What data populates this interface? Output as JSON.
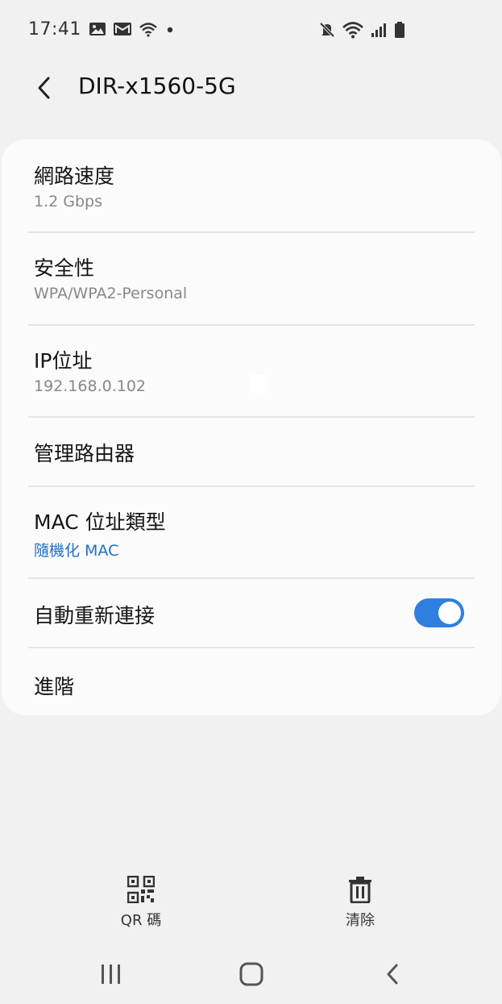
{
  "status_bar": {
    "time": "17:41",
    "left_icons": [
      "gallery-icon",
      "mail-icon",
      "wifi-calling-icon",
      "dot-icon"
    ],
    "right_icons": [
      "mute-icon",
      "wifi-icon",
      "signal-icon",
      "battery-icon"
    ]
  },
  "header": {
    "back_icon": "chevron-left-icon",
    "title": "DIR-x1560-5G"
  },
  "settings": [
    {
      "label": "網路速度",
      "value": "1.2 Gbps"
    },
    {
      "label": "安全性",
      "value": "WPA/WPA2-Personal"
    },
    {
      "label": "IP位址",
      "value": "192.168.0.102"
    },
    {
      "label": "管理路由器"
    },
    {
      "label": "MAC 位址類型",
      "value": "隨機化 MAC"
    },
    {
      "label": "自動重新連接",
      "toggle": true
    },
    {
      "label": "進階"
    }
  ],
  "bottom_actions": [
    {
      "label": "QR 碼",
      "icon": "qr-code-icon"
    },
    {
      "label": "清除",
      "icon": "trash-icon"
    }
  ],
  "navigation": {
    "recents_icon": "recents-icon",
    "home_icon": "home-icon",
    "back_icon": "back-icon"
  },
  "colors": {
    "background": "#f1f1f1",
    "card": "#fbfbfb",
    "accent": "#2f7fe0",
    "link_text": "#1e6fc8"
  }
}
